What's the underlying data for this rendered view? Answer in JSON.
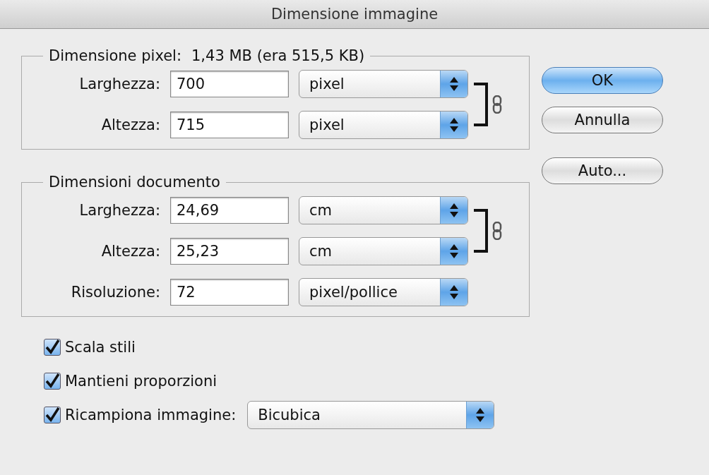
{
  "window": {
    "title": "Dimensione immagine"
  },
  "pixel_dimensions": {
    "legend": "Dimensione pixel:",
    "size": "1,43 MB (era 515,5 KB)",
    "linked": true,
    "fields": [
      {
        "label": "Larghezza:",
        "value": "700",
        "unit": "pixel"
      },
      {
        "label": "Altezza:",
        "value": "715",
        "unit": "pixel"
      }
    ]
  },
  "document_size": {
    "legend": "Dimensioni documento",
    "linked": true,
    "fields": [
      {
        "label": "Larghezza:",
        "value": "24,69",
        "unit": "cm"
      },
      {
        "label": "Altezza:",
        "value": "25,23",
        "unit": "cm"
      },
      {
        "label": "Risoluzione:",
        "value": "72",
        "unit": "pixel/pollice"
      }
    ]
  },
  "buttons": [
    {
      "label": "OK",
      "default": true
    },
    {
      "label": "Annulla",
      "default": false
    },
    {
      "label": "Auto...",
      "default": false
    }
  ],
  "options": [
    {
      "label": "Scala stili",
      "checked": true
    },
    {
      "label": "Mantieni proporzioni",
      "checked": true
    },
    {
      "label": "Ricampiona immagine:",
      "checked": true,
      "select": "Bicubica"
    }
  ]
}
